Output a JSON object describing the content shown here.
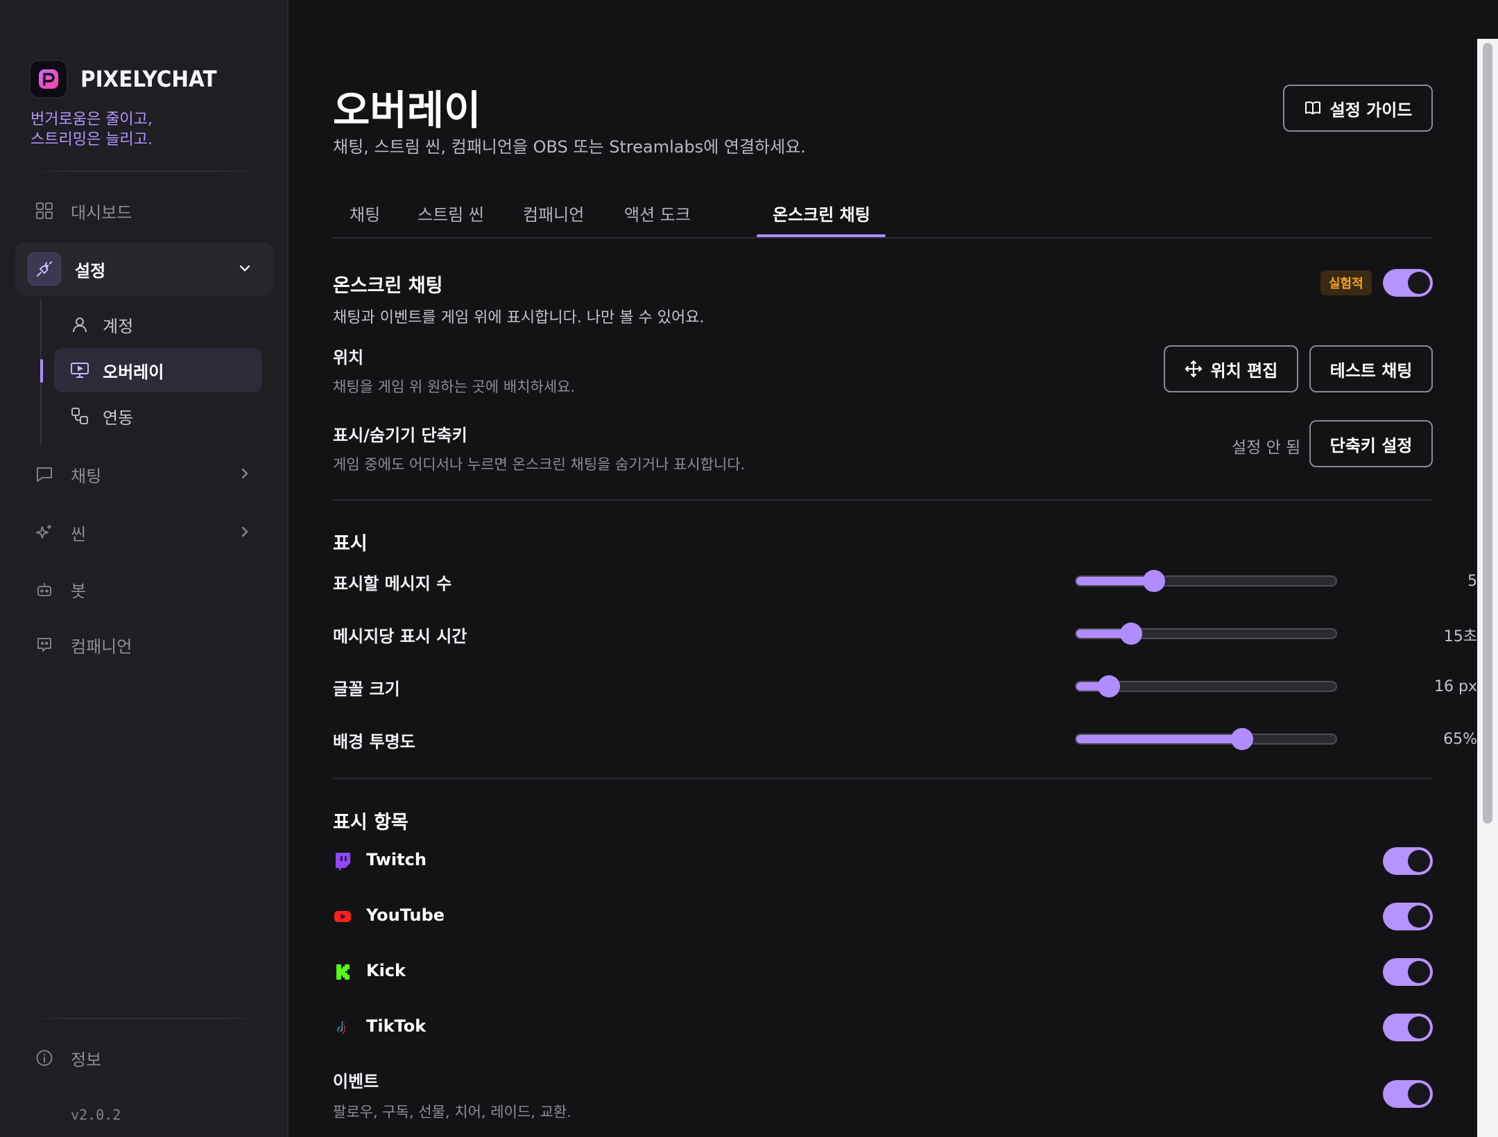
{
  "brand": {
    "name": "PIXELYCHAT",
    "tagline": "번거로움은 줄이고,\n스트리밍은 늘리고.",
    "accent": "#b18cff"
  },
  "sidebar": {
    "items": [
      {
        "label": "대시보드",
        "icon": "grid-icon"
      },
      {
        "label": "설정",
        "icon": "plug-icon",
        "expanded": true
      },
      {
        "label": "채팅",
        "icon": "chat-bubble-icon"
      },
      {
        "label": "씬",
        "icon": "sparkles-icon"
      },
      {
        "label": "봇",
        "icon": "bot-icon"
      },
      {
        "label": "컴패니언",
        "icon": "companion-icon"
      }
    ],
    "sub_items": [
      {
        "label": "계정",
        "icon": "user-icon"
      },
      {
        "label": "오버레이",
        "icon": "monitor-icon",
        "active": true
      },
      {
        "label": "연동",
        "icon": "link-icon"
      }
    ],
    "info_label": "정보",
    "version": "v2.0.2"
  },
  "header": {
    "title": "오버레이",
    "subtitle": "채팅, 스트림 씬, 컴패니언을 OBS 또는 Streamlabs에 연결하세요.",
    "guide_button": "설정 가이드"
  },
  "tabs": [
    "채팅",
    "스트림 씬",
    "컴패니언",
    "액션 도크",
    "온스크린 채팅"
  ],
  "active_tab": "온스크린 채팅",
  "onscreen": {
    "title": "온스크린 채팅",
    "badge": "실험적",
    "enabled": true,
    "description": "채팅과 이벤트를 게임 위에 표시합니다. 나만 볼 수 있어요.",
    "position_label": "위치",
    "position_desc": "채팅을 게임 위 원하는 곳에 배치하세요.",
    "edit_position_button": "위치 편집",
    "test_chat_button": "테스트 채팅",
    "hotkey_label": "표시/숨기기 단축키",
    "hotkey_desc": "게임 중에도 어디서나 누르면 온스크린 채팅을 숨기거나 표시합니다.",
    "hotkey_status": "설정 안 됨",
    "hotkey_button": "단축키 설정"
  },
  "display": {
    "title": "표시",
    "sliders": [
      {
        "label": "표시할 메시지 수",
        "value_text": "5",
        "fraction": 0.3
      },
      {
        "label": "메시지당 표시 시간",
        "value_text": "15초",
        "fraction": 0.21
      },
      {
        "label": "글꼴 크기",
        "value_text": "16 px",
        "fraction": 0.125
      },
      {
        "label": "배경 투명도",
        "value_text": "65%",
        "fraction": 0.64
      }
    ]
  },
  "items": {
    "title": "표시 항목",
    "sources": [
      {
        "name": "Twitch",
        "icon": "twitch-icon",
        "color": "#9146ff",
        "enabled": true
      },
      {
        "name": "YouTube",
        "icon": "youtube-icon",
        "color": "#ff0000",
        "enabled": true
      },
      {
        "name": "Kick",
        "icon": "kick-icon",
        "color": "#53fc18",
        "enabled": true
      },
      {
        "name": "TikTok",
        "icon": "tiktok-icon",
        "color": "#ffffff",
        "enabled": true
      }
    ],
    "events_label": "이벤트",
    "events_desc": "팔로우, 구독, 선물, 치어, 레이드, 교환.",
    "events_enabled": true
  }
}
